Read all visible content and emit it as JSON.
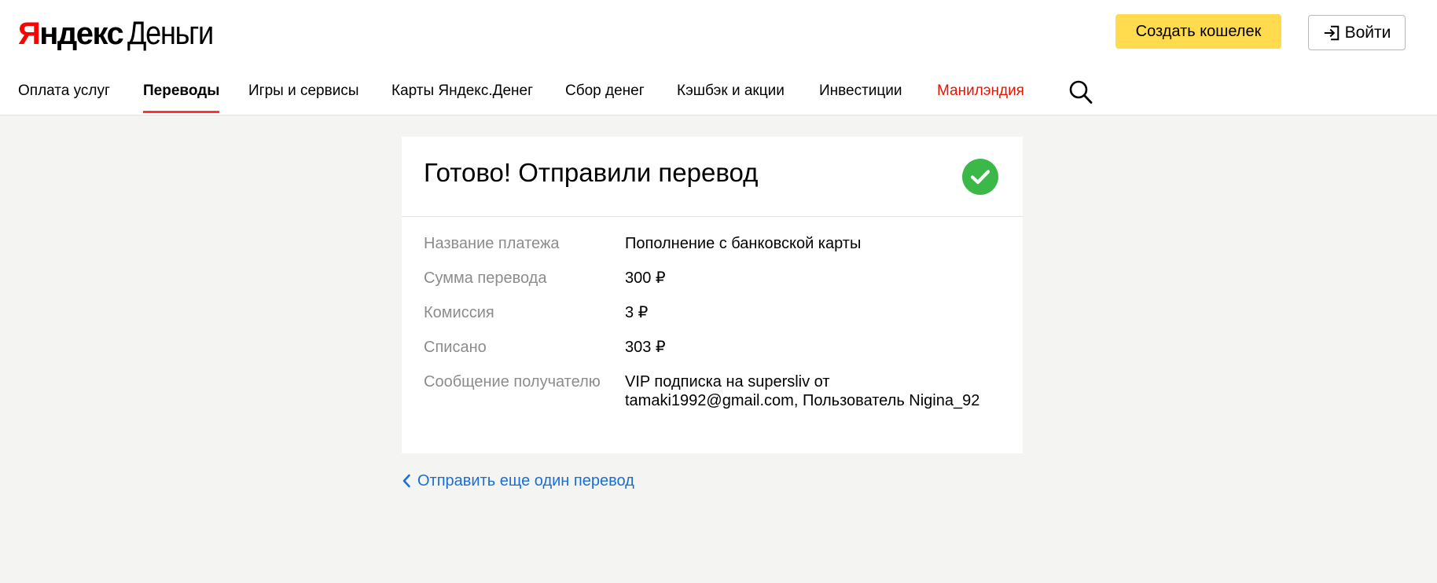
{
  "header": {
    "logo": {
      "yandex_first": "Я",
      "yandex_rest": "ндекс",
      "product": "Деньги"
    },
    "create_wallet_label": "Создать кошелек",
    "login_label": "Войти",
    "login_icon": "login-icon",
    "search_icon": "search-icon"
  },
  "nav": {
    "items": [
      {
        "label": "Оплата услуг"
      },
      {
        "label": "Переводы",
        "active": true
      },
      {
        "label": "Игры и сервисы"
      },
      {
        "label": "Карты Яндекс.Денег"
      },
      {
        "label": "Сбор денег"
      },
      {
        "label": "Кэшбэк и акции"
      },
      {
        "label": "Инвестиции"
      },
      {
        "label": "Манилэндия",
        "color": "#e61400"
      }
    ]
  },
  "card": {
    "title": "Готово! Отправили перевод",
    "status_icon": "check-circle-icon",
    "status_color": "#3bb847",
    "rows": [
      {
        "label": "Название платежа",
        "value": "Пополнение с банковской карты"
      },
      {
        "label": "Сумма перевода",
        "value": "300 ₽"
      },
      {
        "label": "Комиссия",
        "value": "3 ₽"
      },
      {
        "label": "Списано",
        "value": "303 ₽"
      },
      {
        "label": "Сообщение получателю",
        "value": "VIP подписка на supersliv от tamaki1992@gmail.com, Пользователь Nigina_92"
      }
    ]
  },
  "back_link": {
    "label": "Отправить еще один перевод",
    "icon": "chevron-left-icon"
  },
  "colors": {
    "accent_yellow": "#ffdb4d",
    "link_blue": "#1a6ed8",
    "active_underline": "#ff3333",
    "background": "#f4f4f2"
  }
}
